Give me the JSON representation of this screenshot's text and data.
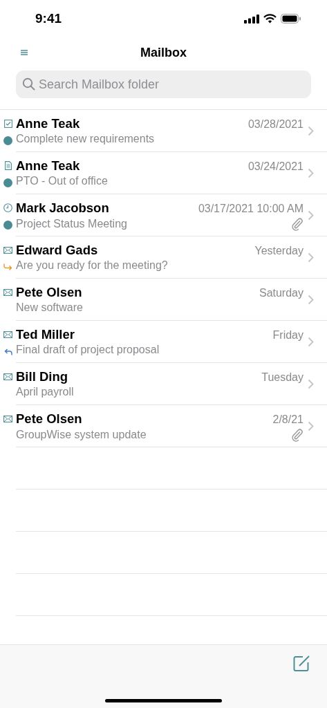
{
  "status_bar": {
    "time": "9:41"
  },
  "header": {
    "title": "Mailbox"
  },
  "search": {
    "placeholder": "Search Mailbox folder"
  },
  "messages": [
    {
      "kind": "task",
      "sender": "Anne Teak",
      "date": "03/28/2021",
      "subject": "Complete new requirements",
      "flagged": true,
      "forwarded": false,
      "replied": false,
      "attachment": false
    },
    {
      "kind": "note",
      "sender": "Anne Teak",
      "date": "03/24/2021",
      "subject": "PTO - Out of office",
      "flagged": true,
      "forwarded": false,
      "replied": false,
      "attachment": false
    },
    {
      "kind": "appointment",
      "sender": "Mark Jacobson",
      "date": "03/17/2021 10:00 AM",
      "subject": "Project Status Meeting",
      "flagged": true,
      "forwarded": false,
      "replied": false,
      "attachment": true
    },
    {
      "kind": "mail",
      "sender": "Edward Gads",
      "date": "Yesterday",
      "subject": "Are you ready for the meeting?",
      "flagged": false,
      "forwarded": true,
      "replied": false,
      "attachment": false
    },
    {
      "kind": "mail",
      "sender": "Pete Olsen",
      "date": "Saturday",
      "subject": "New software",
      "flagged": false,
      "forwarded": false,
      "replied": false,
      "attachment": false
    },
    {
      "kind": "mail",
      "sender": "Ted Miller",
      "date": "Friday",
      "subject": "Final draft of project proposal",
      "flagged": false,
      "forwarded": false,
      "replied": true,
      "attachment": false
    },
    {
      "kind": "mail",
      "sender": "Bill Ding",
      "date": "Tuesday",
      "subject": "April payroll",
      "flagged": false,
      "forwarded": false,
      "replied": false,
      "attachment": false
    },
    {
      "kind": "mail",
      "sender": "Pete Olsen",
      "date": "2/8/21",
      "subject": "GroupWise system update",
      "flagged": false,
      "forwarded": false,
      "replied": false,
      "attachment": true
    }
  ]
}
